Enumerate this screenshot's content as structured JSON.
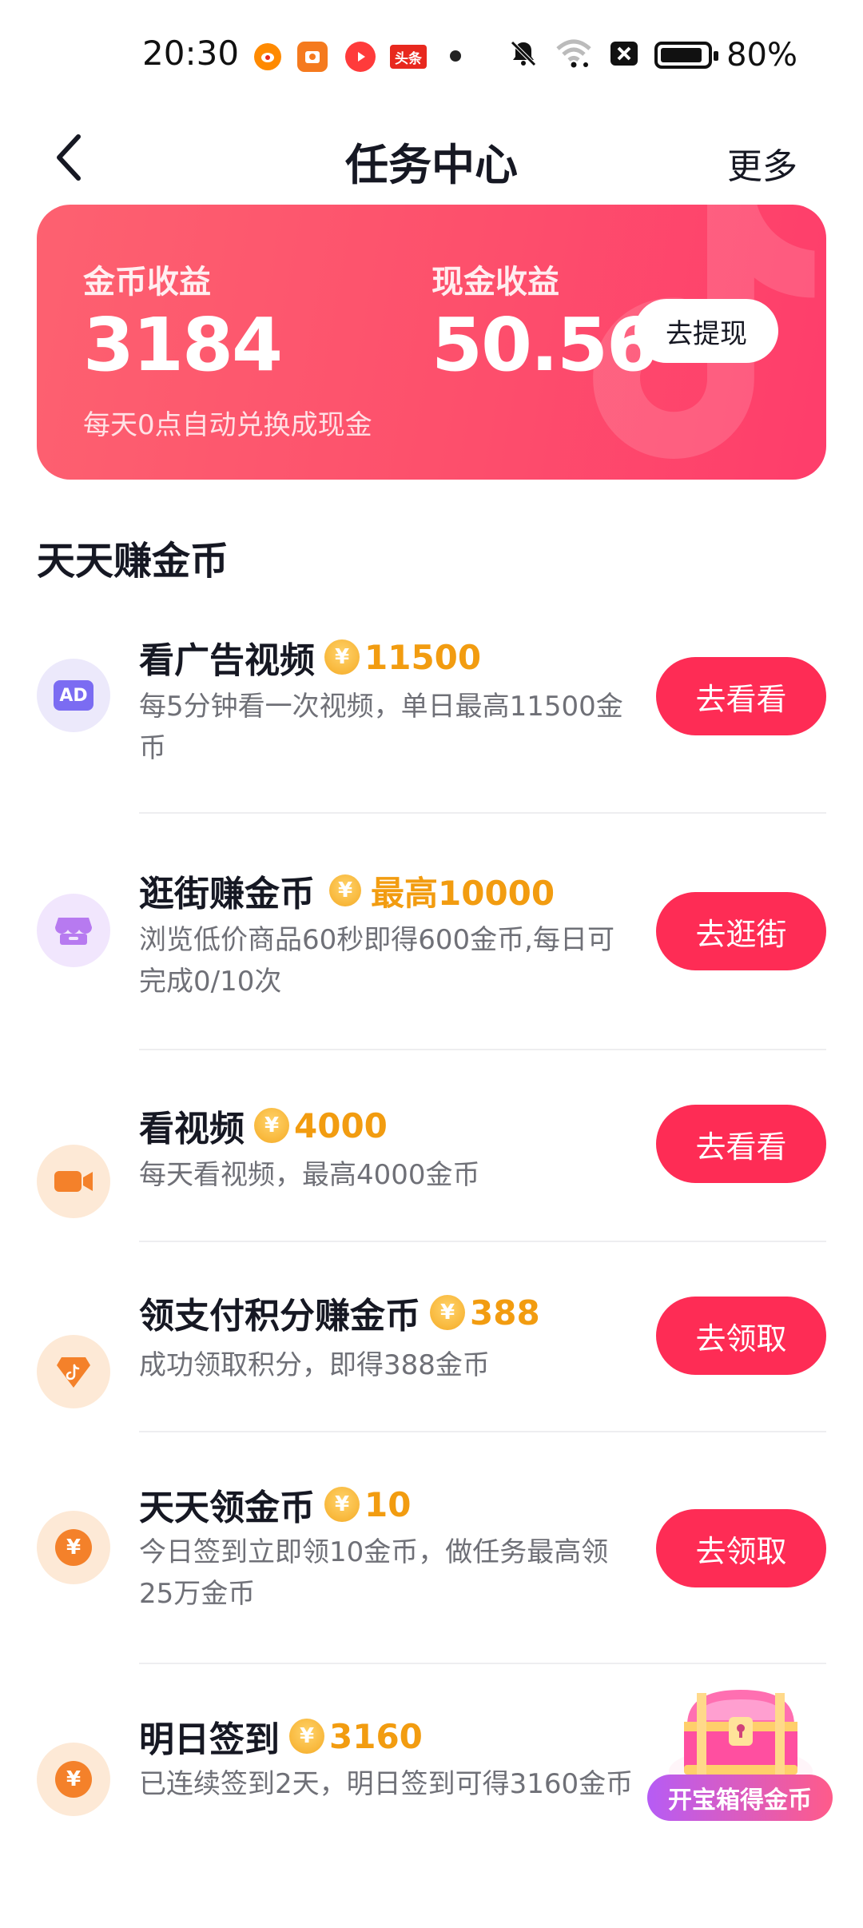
{
  "status_bar": {
    "time": "20:30",
    "apps": [
      "weibo-icon",
      "app-icon",
      "music-icon",
      "toutiao-icon"
    ],
    "app_labels": {
      "toutiao": "头条"
    },
    "battery_percent": "80%",
    "battery_level": 0.8,
    "icons": [
      "bell-muted-icon",
      "wifi-icon",
      "close-box-icon",
      "battery-icon"
    ]
  },
  "nav": {
    "back_icon": "chevron-left-icon",
    "title": "任务中心",
    "more": "更多"
  },
  "earnings": {
    "coin_label": "金币收益",
    "coin_value": "3184",
    "cash_label": "现金收益",
    "cash_value": "50.56",
    "withdraw_button": "去提现",
    "note": "每天0点自动兑换成现金"
  },
  "section": {
    "title": "天天赚金币"
  },
  "tasks": [
    {
      "icon": "ad-icon",
      "icon_text": "AD",
      "title": "看广告视频",
      "reward": "11500",
      "desc": "每5分钟看一次视频，单日最高11500金币",
      "button": "去看看"
    },
    {
      "icon": "shop-icon",
      "title": "逛街赚金币",
      "reward": "最高10000",
      "desc": "浏览低价商品60秒即得600金币,每日可完成0/10次",
      "button": "去逛街"
    },
    {
      "icon": "video-camera-icon",
      "title": "看视频",
      "reward": "4000",
      "desc": "每天看视频，最高4000金币",
      "button": "去看看"
    },
    {
      "icon": "tiktok-diamond-icon",
      "title": "领支付积分赚金币",
      "reward": "388",
      "desc": "成功领取积分，即得388金币",
      "button": "去领取"
    },
    {
      "icon": "yen-coin-icon",
      "title": "天天领金币",
      "reward": "10",
      "desc": "今日签到立即领10金币，做任务最高领25万金币",
      "button": "去领取"
    },
    {
      "icon": "yen-coin-icon",
      "title": "明日签到",
      "reward": "3160",
      "desc": "已连续签到2天，明日签到可得3160金币",
      "button": ""
    }
  ],
  "treasure": {
    "label": "开宝箱得金币"
  },
  "colors": {
    "accent": "#fe2c55",
    "reward": "#f29c10",
    "card_gradient": [
      "#fd6170",
      "#fe3d6b"
    ]
  }
}
